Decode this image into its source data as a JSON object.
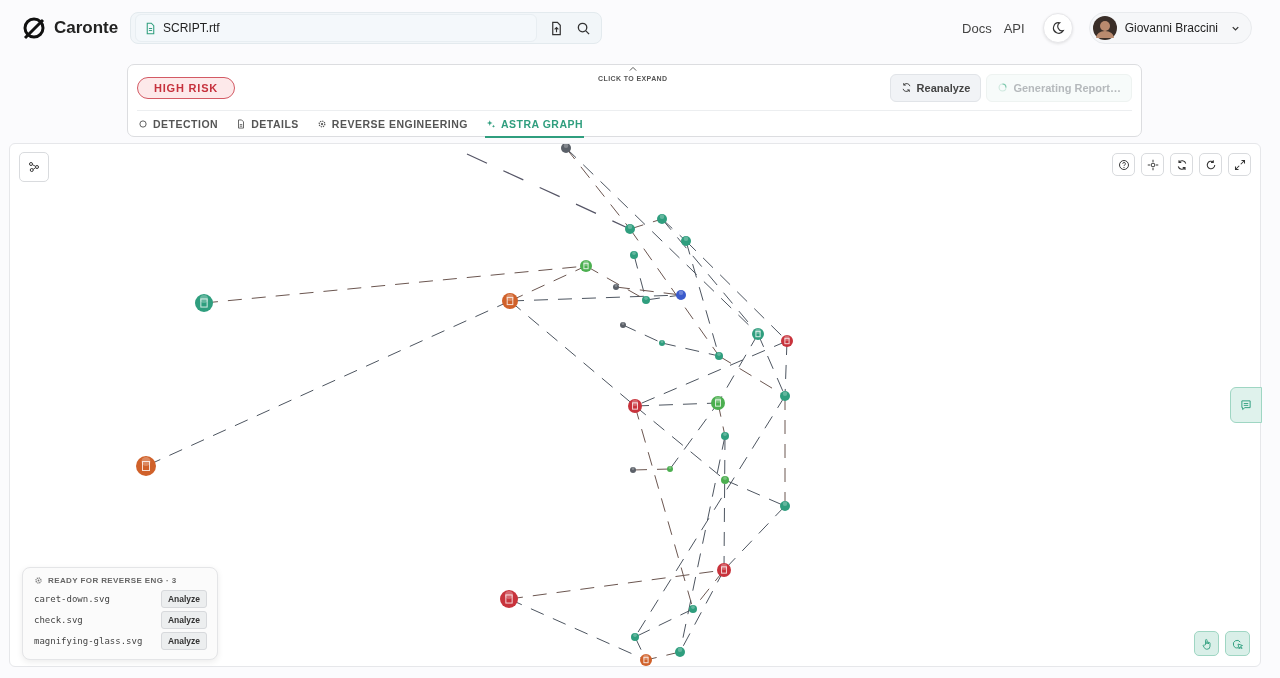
{
  "app": {
    "name": "Caronte"
  },
  "file_field": {
    "value": "SCRIPT.rtf"
  },
  "nav": [
    "Docs",
    "API"
  ],
  "user": {
    "name": "Giovanni Braccini"
  },
  "panel": {
    "risk": "HIGH RISK",
    "expand_hint": "CLICK TO EXPAND",
    "buttons": [
      {
        "label": "Reanalyze",
        "disabled": false
      },
      {
        "label": "Generating Report…",
        "disabled": true
      }
    ],
    "tabs": [
      {
        "label": "DETECTION",
        "selected": false
      },
      {
        "label": "DETAILS",
        "selected": false
      },
      {
        "label": "REVERSE ENGINEERING",
        "selected": false
      },
      {
        "label": "ASTRA GRAPH",
        "selected": true
      }
    ]
  },
  "queue": {
    "title": "READY FOR REVERSE ENG · 3",
    "items": [
      {
        "name": "caret-down.svg",
        "action": "Analyze"
      },
      {
        "name": "check.svg",
        "action": "Analyze"
      },
      {
        "name": "magnifying-glass.svg",
        "action": "Analyze"
      }
    ]
  }
}
